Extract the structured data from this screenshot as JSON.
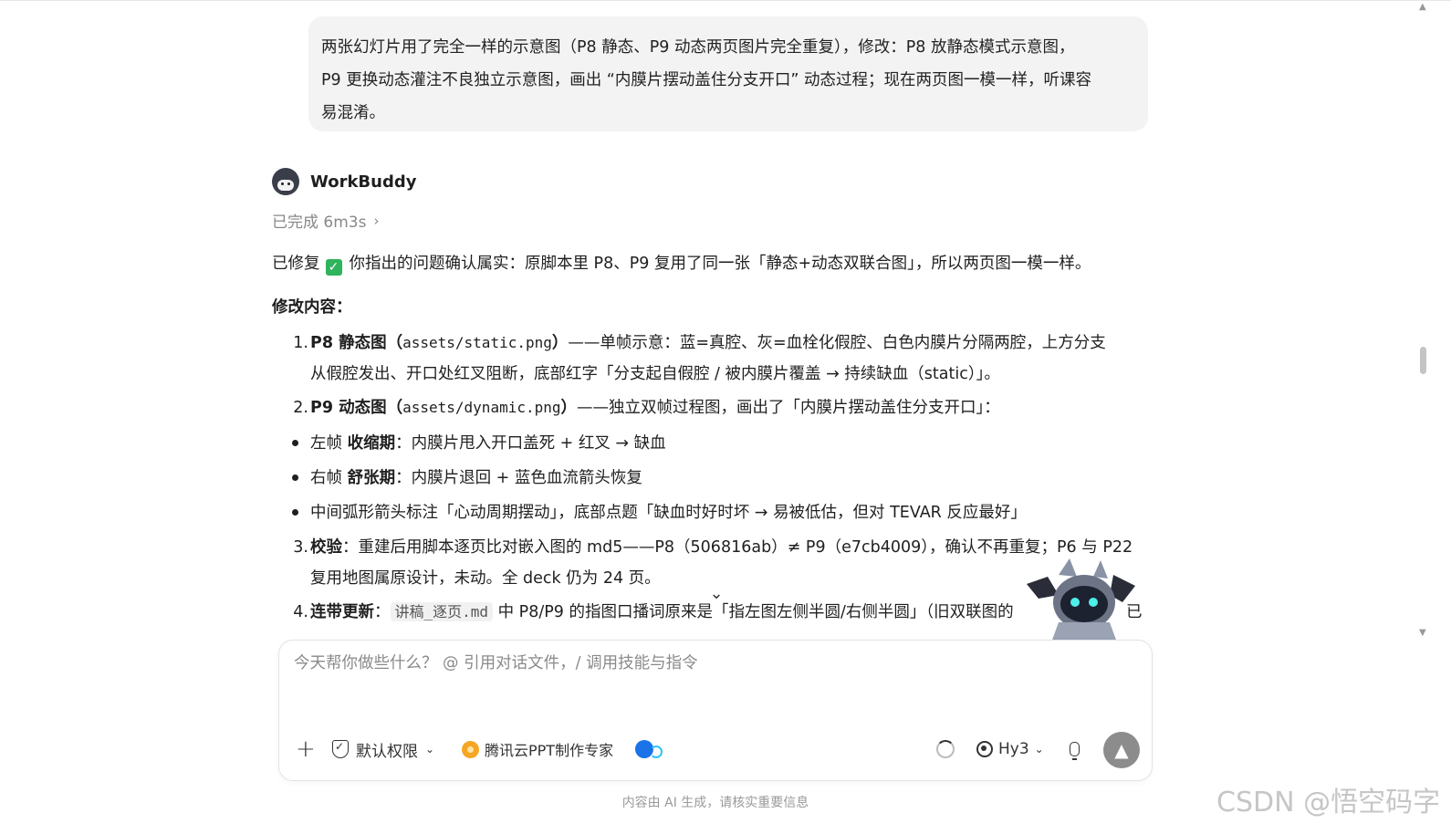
{
  "user_message": {
    "line1": "两张幻灯片用了完全一样的示意图（P8 静态、P9 动态两页图片完全重复），修改：P8 放静态模式示意图，",
    "line2": "P9 更换动态灌注不良独立示意图，画出 “内膜片摆动盖住分支开口” 动态过程；现在两页图一模一样，听课容",
    "line3": "易混淆。"
  },
  "assistant": {
    "name": "WorkBuddy",
    "status": "已完成 6m3s",
    "fixed_label": "已修复",
    "fixed_text": "你指出的问题确认属实：原脚本里 P8、P9 复用了同一张「静态+动态双联合图」，所以两页图一模一样。",
    "section_title": "修改内容：",
    "item1": {
      "num": "1.",
      "title": "P8 静态图",
      "paren_open": "（",
      "code": "assets/static.png",
      "paren_close": "）",
      "desc1": "——单帧示意：蓝=真腔、灰=血栓化假腔、白色内膜片分隔两腔，上方分支",
      "desc2": "从假腔发出、开口处红叉阻断，底部红字「分支起自假腔 / 被内膜片覆盖 → 持续缺血（static）」。"
    },
    "item2": {
      "num": "2.",
      "title": "P9 动态图",
      "paren_open": "（",
      "code": "assets/dynamic.png",
      "paren_close": "）",
      "desc": "——独立双帧过程图，画出了「内膜片摆动盖住分支开口」："
    },
    "bullets": [
      {
        "prefix": "左帧 ",
        "bold": "收缩期",
        "text": "：内膜片甩入开口盖死 + 红叉 → 缺血"
      },
      {
        "prefix": "右帧 ",
        "bold": "舒张期",
        "text": "：内膜片退回 + 蓝色血流箭头恢复"
      },
      {
        "prefix": "",
        "bold": "",
        "text": "中间弧形箭头标注「心动周期摆动」，底部点题「缺血时好时坏 → 易被低估，但对 TEVAR 反应最好」"
      }
    ],
    "item3": {
      "num": "3.",
      "title": "校验",
      "desc1": "：重建后用脚本逐页比对嵌入图的 md5——P8（506816ab）≠ P9（e7cb4009），确认不再重复；P6 与 P22",
      "desc2": "复用地图属原设计，未动。全 deck 仍为 24 页。"
    },
    "item4": {
      "num": "4.",
      "title": "连带更新",
      "colon": "：",
      "code": "讲稿_逐页.md",
      "desc": " 中 P8/P9 的指图口播词原来是「指左图左侧半圆/右侧半圆」（旧双联图的",
      "tail": "已"
    }
  },
  "composer": {
    "placeholder": "今天帮你做些什么？ @ 引用对话文件，/ 调用技能与指令",
    "plus_label": "+",
    "permission_label": "默认权限",
    "skill_label": "腾讯云PPT制作专家",
    "model_label": "Hy3",
    "send_icon": "▲"
  },
  "icons": {
    "check": "✓",
    "chevron_right": "›",
    "chevron_down": "⌄",
    "dropdown": "⌄",
    "scroll_up": "▲",
    "scroll_down": "▼"
  },
  "footer": {
    "disclaimer": "内容由 AI 生成，请核实重要信息",
    "watermark": "CSDN @悟空码字"
  },
  "colors": {
    "check_green": "#2fb35d",
    "bubble_bg": "#f3f3f3",
    "send_button": "#8c8c8c"
  }
}
